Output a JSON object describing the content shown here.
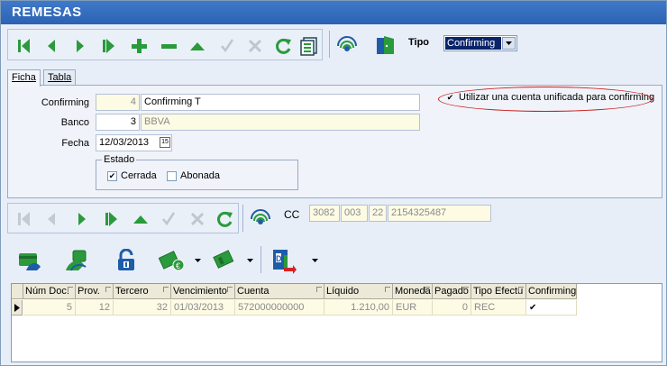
{
  "window": {
    "title": "REMESAS"
  },
  "toolbar": {
    "buttons": [
      "first-icon",
      "prev-icon",
      "next-icon",
      "last-icon",
      "add-icon",
      "delete-icon",
      "edit-icon",
      "confirm-icon",
      "cancel-icon",
      "refresh-icon",
      "list-icon",
      "network-icon",
      "exit-icon"
    ]
  },
  "tipo": {
    "label": "Tipo",
    "value": "Confirming"
  },
  "tabs": [
    {
      "label": "Ficha",
      "active": true
    },
    {
      "label": "Tabla",
      "active": false
    }
  ],
  "form": {
    "confirming_label": "Confirming",
    "confirming_code": "4",
    "confirming_name": "Confirming T",
    "banco_label": "Banco",
    "banco_code": "3",
    "banco_name": "BBVA",
    "fecha_label": "Fecha",
    "fecha_value": "12/03/2013",
    "calendar_label": "15",
    "estado_label": "Estado",
    "cerrada_label": "Cerrada",
    "cerrada_checked": true,
    "abonada_label": "Abonada",
    "abonada_checked": false,
    "unificada_label": "Utilizar una cuenta unificada para confirming",
    "unificada_checked": true
  },
  "cc": {
    "label": "CC",
    "entidad": "3082",
    "oficina": "003",
    "dc": "22",
    "cuenta": "2154325487"
  },
  "grid": {
    "columns": [
      "Núm Doc.",
      "Prov.",
      "Tercero",
      "Vencimiento",
      "Cuenta",
      "Líquido",
      "Moneda",
      "Pagado",
      "Tipo Efectu",
      "Confirming"
    ],
    "rows": [
      {
        "num_doc": "5",
        "prov": "12",
        "tercero": "32",
        "vencimiento": "01/03/2013",
        "cuenta": "572000000000",
        "liquido": "1.210,00",
        "moneda": "EUR",
        "pagado": "0",
        "tipo_efecto": "REC",
        "confirming": true
      }
    ]
  },
  "colors": {
    "title_bar": "#2c62b3",
    "readonly_bg": "#fdfbe4",
    "highlight_ellipse": "#c81e1e",
    "green_icons": "#2a9a3c"
  }
}
